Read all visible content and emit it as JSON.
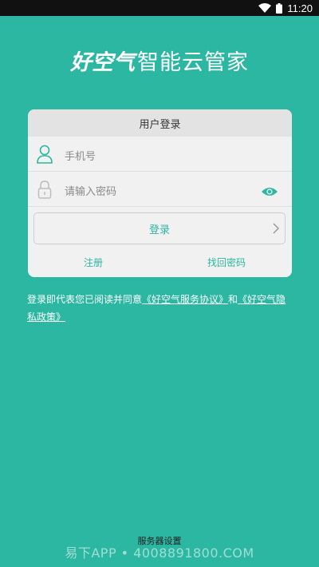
{
  "status_bar": {
    "time": "11:20"
  },
  "header": {
    "brand": "好空气",
    "title": "智能云管家"
  },
  "login_card": {
    "title": "用户登录",
    "phone_placeholder": "手机号",
    "password_placeholder": "请输入密码",
    "login_label": "登录",
    "register_label": "注册",
    "find_password_label": "找回密码"
  },
  "agreement": {
    "prefix": "登录即代表您已阅读并同意",
    "service_link": "《好空气服务协议》",
    "and": "和",
    "privacy_link": "《好空气隐私政策》"
  },
  "footer": {
    "server_settings": "服务器设置",
    "watermark": "易下APP • 4008891800.COM"
  },
  "colors": {
    "accent": "#2bb7a1",
    "card": "#f1f1f1",
    "card_header": "#e3e3e3"
  },
  "icons": [
    "wifi-icon",
    "battery-icon",
    "user-icon",
    "lock-icon",
    "eye-icon",
    "chevron-right-icon"
  ]
}
